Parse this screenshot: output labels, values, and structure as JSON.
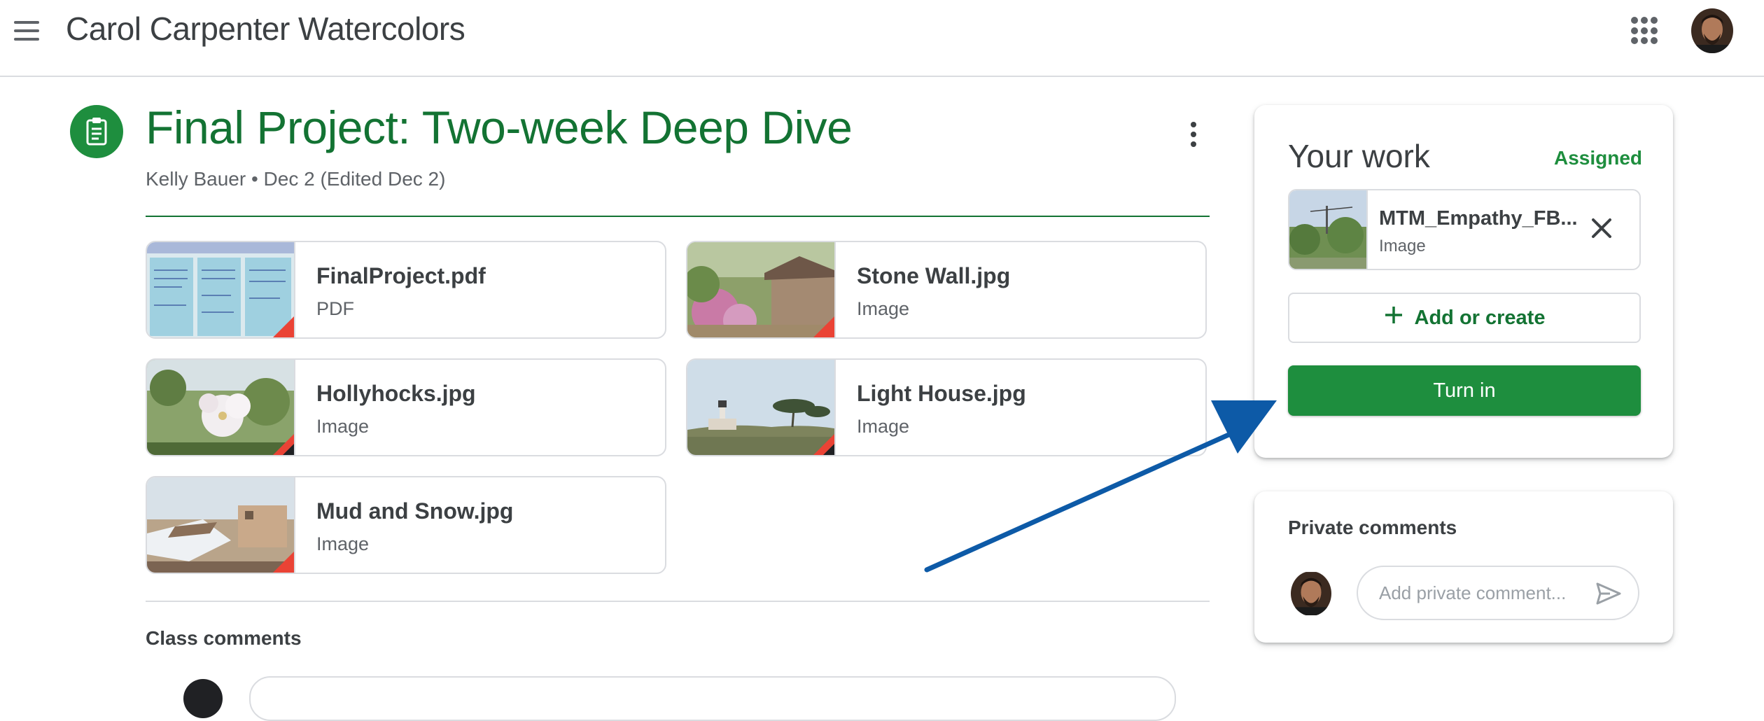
{
  "header": {
    "app_title": "Carol Carpenter Watercolors"
  },
  "assignment": {
    "title": "Final Project: Two-week Deep Dive",
    "meta": "Kelly Bauer • Dec 2 (Edited Dec 2)"
  },
  "attachments": [
    {
      "name": "FinalProject.pdf",
      "type": "PDF"
    },
    {
      "name": "Stone Wall.jpg",
      "type": "Image"
    },
    {
      "name": "Hollyhocks.jpg",
      "type": "Image"
    },
    {
      "name": "Light House.jpg",
      "type": "Image"
    },
    {
      "name": "Mud and Snow.jpg",
      "type": "Image"
    }
  ],
  "class_comments": {
    "title": "Class comments"
  },
  "your_work": {
    "title": "Your work",
    "status": "Assigned",
    "attached_file": {
      "name": "MTM_Empathy_FB...",
      "type": "Image"
    },
    "add_label": "Add or create",
    "turn_in_label": "Turn in"
  },
  "private_comments": {
    "title": "Private comments",
    "placeholder": "Add private comment..."
  },
  "colors": {
    "brand_green": "#1e8e3e",
    "title_green": "#137333",
    "arrow_blue": "#0d5aa7"
  }
}
